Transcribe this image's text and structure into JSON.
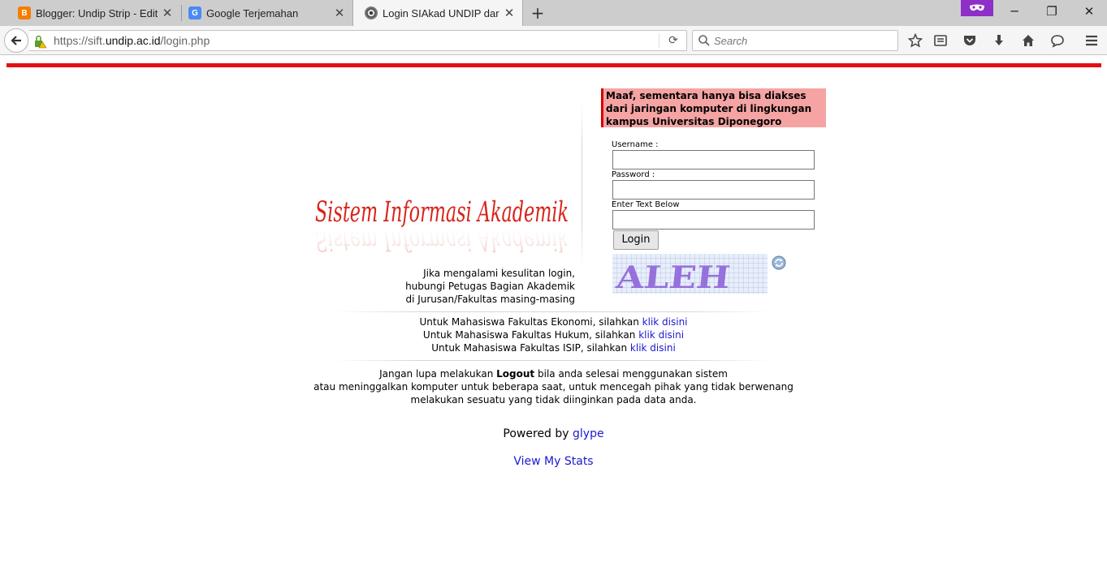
{
  "browser": {
    "tabs": [
      {
        "title": "Blogger: Undip Strip - Edit...",
        "icon": "blogger-icon",
        "active": false
      },
      {
        "title": "Google Terjemahan",
        "icon": "google-translate-icon",
        "active": false
      },
      {
        "title": "Login SIAkad UNDIP dari i...",
        "icon": "undip-icon",
        "active": true
      }
    ],
    "url_prefix": "https://sift.",
    "url_domain": "undip.ac.id",
    "url_path": "/login.php",
    "search_placeholder": "Search"
  },
  "page": {
    "logo_text": "Sistem Informasi Akademik",
    "warning": "Maaf, sementara hanya bisa diakses dari jaringan komputer di lingkungan kampus Universitas Diponegoro",
    "help_lines": [
      "Jika mengalami kesulitan login,",
      "hubungi Petugas Bagian Akademik",
      "di Jurusan/Fakultas masing-masing"
    ],
    "form": {
      "username_label": "Username :",
      "password_label": "Password :",
      "captcha_label": "Enter Text Below",
      "login_button": "Login",
      "captcha_text": "ALEH"
    },
    "faculty_links": [
      {
        "text": "Untuk Mahasiswa Fakultas Ekonomi, silahkan ",
        "link": "klik disini"
      },
      {
        "text": "Untuk Mahasiswa Fakultas Hukum, silahkan ",
        "link": "klik disini"
      },
      {
        "text": "Untuk Mahasiswa Fakultas ISIP, silahkan ",
        "link": "klik disini"
      }
    ],
    "logout_notice": {
      "before": "Jangan lupa melakukan ",
      "bold": "Logout",
      "after": " bila anda selesai menggunakan sistem",
      "line2": "atau meninggalkan komputer untuk beberapa saat, untuk mencegah pihak yang tidak berwenang",
      "line3": "melakukan sesuatu yang tidak diinginkan pada data anda."
    },
    "powered_by": "Powered by ",
    "powered_link": "glype",
    "stats_link": "View My Stats"
  },
  "colors": {
    "accent_red": "#e30f12",
    "warning_bg": "#f5a3a3",
    "link": "#1a1ad0",
    "private_purple": "#8e2fc7"
  }
}
